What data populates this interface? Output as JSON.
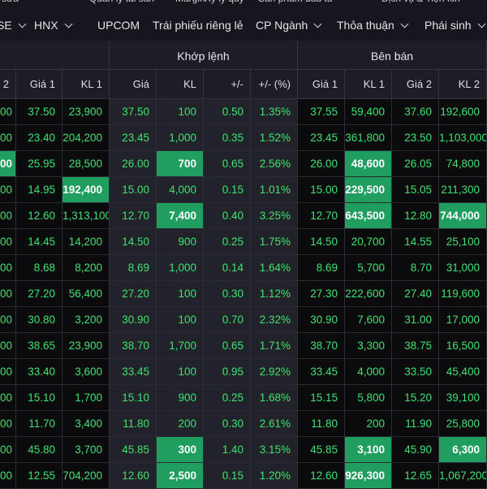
{
  "top_clipped": [
    "ch sửa",
    "Quản lý tài sản",
    "Margin",
    "Ký lý quỹ",
    "Sản phẩm đầu tư",
    "Dịch vụ & Tiện ích"
  ],
  "tabs": [
    {
      "label": "SE",
      "dropdown": true
    },
    {
      "label": "HNX",
      "dropdown": true
    },
    {
      "label": "UPCOM",
      "dropdown": false
    },
    {
      "label": "Trái phiếu riêng lẻ",
      "dropdown": false
    },
    {
      "label": "CP Ngành",
      "dropdown": true
    },
    {
      "label": "Thỏa thuận",
      "dropdown": true
    },
    {
      "label": "Phái sinh",
      "dropdown": true
    }
  ],
  "groups": {
    "matched": "Khớp lệnh",
    "sell": "Bên bán"
  },
  "columns": [
    "2",
    "Giá 1",
    "KL 1",
    "Giá",
    "KL",
    "+/-",
    "+/- (%)",
    "Giá 1",
    "KL 1",
    "Giá 2",
    "KL 2"
  ],
  "rows": [
    [
      "00",
      "37.50",
      "23,900",
      "37.50",
      "100",
      "0.50",
      "1.35%",
      "37.55",
      "59,400",
      "37.60",
      "192,600"
    ],
    [
      "00",
      "23.40",
      "204,200",
      "23.45",
      "1,000",
      "0.35",
      "1.52%",
      "23.45",
      "361,800",
      "23.50",
      "1,103,000"
    ],
    [
      "00",
      "25.95",
      "28,500",
      "26.00",
      "700",
      "0.65",
      "2.56%",
      "26.00",
      "48,600",
      "26.05",
      "74,800"
    ],
    [
      "00",
      "14.95",
      "192,400",
      "15.00",
      "4,000",
      "0.15",
      "1.01%",
      "15.00",
      "229,500",
      "15.05",
      "211,300"
    ],
    [
      "00",
      "12.60",
      "1,313,100",
      "12.70",
      "7,400",
      "0.40",
      "3.25%",
      "12.70",
      "643,500",
      "12.80",
      "744,000"
    ],
    [
      "00",
      "14.45",
      "14,200",
      "14.50",
      "900",
      "0.25",
      "1.75%",
      "14.50",
      "20,700",
      "14.55",
      "25,100"
    ],
    [
      "00",
      "8.68",
      "8,200",
      "8.69",
      "1,000",
      "0.14",
      "1.64%",
      "8.69",
      "5,700",
      "8.70",
      "31,000"
    ],
    [
      "00",
      "27.20",
      "56,400",
      "27.20",
      "100",
      "0.30",
      "1.12%",
      "27.30",
      "222,600",
      "27.40",
      "119,600"
    ],
    [
      "00",
      "30.80",
      "3,200",
      "30.90",
      "100",
      "0.70",
      "2.32%",
      "30.90",
      "7,600",
      "31.00",
      "17,000"
    ],
    [
      "00",
      "38.65",
      "23,900",
      "38.70",
      "1,700",
      "0.65",
      "1.71%",
      "38.70",
      "3,300",
      "38.75",
      "16,500"
    ],
    [
      "00",
      "33.40",
      "3,600",
      "33.45",
      "100",
      "0.95",
      "2.92%",
      "33.45",
      "4,000",
      "33.50",
      "45,400"
    ],
    [
      "00",
      "15.10",
      "1,700",
      "15.10",
      "900",
      "0.25",
      "1.68%",
      "15.15",
      "5,800",
      "15.20",
      "39,100"
    ],
    [
      "00",
      "11.70",
      "3,400",
      "11.80",
      "200",
      "0.30",
      "2.61%",
      "11.80",
      "200",
      "11.90",
      "25,800"
    ],
    [
      "00",
      "45.80",
      "3,700",
      "45.85",
      "300",
      "1.40",
      "3.15%",
      "45.85",
      "3,100",
      "45.90",
      "6,300"
    ],
    [
      "00",
      "12.55",
      "704,200",
      "12.60",
      "2,500",
      "0.15",
      "1.20%",
      "12.60",
      "926,300",
      "12.65",
      "1,067,200"
    ]
  ],
  "highlights": [
    [
      2,
      0
    ],
    [
      2,
      4
    ],
    [
      2,
      8
    ],
    [
      3,
      2
    ],
    [
      3,
      8
    ],
    [
      4,
      4
    ],
    [
      4,
      8
    ],
    [
      4,
      10
    ],
    [
      13,
      4
    ],
    [
      13,
      8
    ],
    [
      13,
      10
    ],
    [
      14,
      4
    ],
    [
      14,
      8
    ]
  ],
  "colors": {
    "up": "#3fe26e",
    "highlight": "#1f9e5f",
    "background": "#16161e",
    "header": "#1d1d27"
  }
}
